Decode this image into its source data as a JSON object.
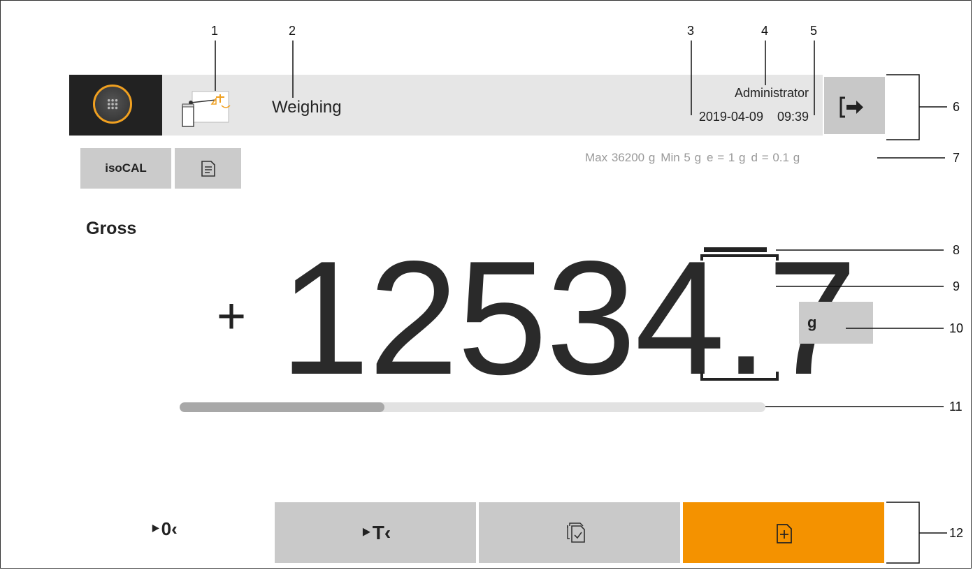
{
  "header": {
    "app_title": "Weighing",
    "user": "Administrator",
    "date": "2019-04-09",
    "time": "09:39",
    "menu_icon": "grid-menu-icon",
    "app_icon": "weighing-app-icon",
    "logout_icon": "logout-icon"
  },
  "toolbar": {
    "isocal_label": "isoCAL",
    "document_icon": "document-icon"
  },
  "specs": {
    "max": "Max 36200 g",
    "min": "Min 5 g",
    "e": "e = 1 g",
    "d": "d = 0.1 g"
  },
  "display": {
    "mode": "Gross",
    "sign": "+",
    "value": "12534.7",
    "unit": "g",
    "progress": 0.35
  },
  "actions": {
    "zero_label": "‣0‹",
    "tare_label": "‣T‹",
    "print_icon": "print-copy-icon",
    "new_icon": "new-document-icon",
    "new_color": "#f49200"
  },
  "callouts": [
    "1",
    "2",
    "3",
    "4",
    "5",
    "6",
    "7",
    "8",
    "9",
    "10",
    "11",
    "12"
  ]
}
